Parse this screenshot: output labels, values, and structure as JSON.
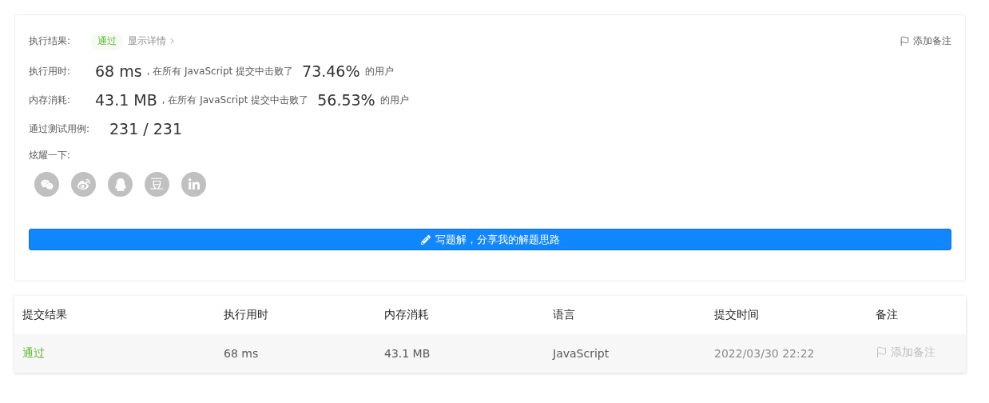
{
  "result": {
    "label": "执行结果:",
    "status": {
      "text": "通过",
      "kind": "accepted"
    },
    "details_link": "显示详情",
    "add_note": {
      "label": "添加备注",
      "disabled": false
    }
  },
  "stats": [
    {
      "label": "执行用时:",
      "value": "68 ms",
      "middle": ", 在所有 JavaScript 提交中击败了",
      "percent": "73.46%",
      "suffix": "的用户"
    },
    {
      "label": "内存消耗:",
      "value": "43.1 MB",
      "middle": ", 在所有 JavaScript 提交中击败了",
      "percent": "56.53%",
      "suffix": "的用户"
    }
  ],
  "tests": {
    "label": "通过测试用例:",
    "value": "231 / 231"
  },
  "share": {
    "label": "炫耀一下:",
    "buttons": [
      {
        "kind": "wechat"
      },
      {
        "kind": "weibo"
      },
      {
        "kind": "qq"
      },
      {
        "kind": "glyph",
        "glyph": "豆"
      },
      {
        "kind": "linkedin"
      }
    ]
  },
  "write_solution_button": "写题解，分享我的解题思路",
  "table": {
    "columns": [
      "提交结果",
      "执行用时",
      "内存消耗",
      "语言",
      "提交时间",
      "备注"
    ],
    "rows": [
      {
        "status": {
          "text": "通过",
          "kind": "accepted"
        },
        "runtime": "68 ms",
        "memory": "43.1 MB",
        "language": "JavaScript",
        "time": "2022/03/30 22:22",
        "note": {
          "label": "添加备注",
          "disabled": true
        }
      }
    ]
  }
}
